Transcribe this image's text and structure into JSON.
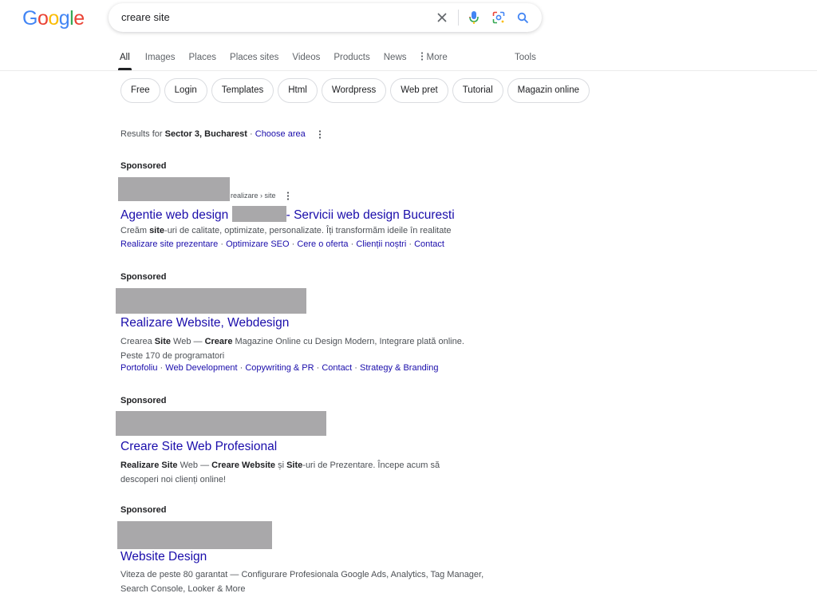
{
  "logo": {
    "text": "Google",
    "colors": [
      "#4285f4",
      "#ea4335",
      "#fbbc05",
      "#4285f4",
      "#34a853",
      "#ea4335"
    ]
  },
  "search": {
    "query": "creare site"
  },
  "icons": {
    "clear": "close-icon",
    "mic": "microphone-icon",
    "lens": "lens-icon",
    "search": "search-icon",
    "more": "more-vert-icon"
  },
  "tabs": [
    {
      "label": "All",
      "active": true
    },
    {
      "label": "Images"
    },
    {
      "label": "Places"
    },
    {
      "label": "Places sites"
    },
    {
      "label": "Videos"
    },
    {
      "label": "Products"
    },
    {
      "label": "News"
    },
    {
      "label": "More"
    }
  ],
  "tools_label": "Tools",
  "chips": [
    "Free",
    "Login",
    "Templates",
    "Html",
    "Wordpress",
    "Web pret",
    "Tutorial",
    "Magazin online"
  ],
  "location": {
    "prefix": "Results for ",
    "place": "Sector 3, Bucharest",
    "sep": " · ",
    "link": "Choose area"
  },
  "ads": [
    {
      "sponsored": "Sponsored",
      "breadcrumb": "realizare › site",
      "title_a": "Agentie web design ",
      "title_b": "- Servicii web design Bucuresti",
      "desc_html": [
        "Creăm ",
        "site",
        "-uri de calitate, optimizate, personalizate. Îți transformăm ideile în realitate"
      ],
      "sitelinks": [
        "Realizare site prezentare",
        "Optimizare SEO",
        "Cere o oferta",
        "Clienții noștri",
        "Contact"
      ]
    },
    {
      "sponsored": "Sponsored",
      "title": "Realizare Website, Webdesign",
      "desc_line1": [
        "Crearea ",
        "Site",
        " Web — ",
        "Creare",
        " Magazine Online cu Design Modern, Integrare plată online."
      ],
      "desc_line2": "Peste 170 de programatori",
      "sitelinks": [
        "Portofoliu",
        "Web Development",
        "Copywriting & PR",
        "Contact",
        "Strategy & Branding"
      ]
    },
    {
      "sponsored": "Sponsored",
      "title": "Creare Site Web Profesional",
      "desc_line1": [
        "Realizare Site",
        " Web — ",
        "Creare Website",
        " și ",
        "Site",
        "-uri de Prezentare. Începe acum să"
      ],
      "desc_line2": "descoperi noi clienți online!"
    },
    {
      "sponsored": "Sponsored",
      "title": "Website Design",
      "desc_line1": "Viteza de peste 80 garantat — Configurare Profesionala Google Ads, Analytics, Tag Manager,",
      "desc_line2": "Search Console, Looker & More"
    }
  ]
}
